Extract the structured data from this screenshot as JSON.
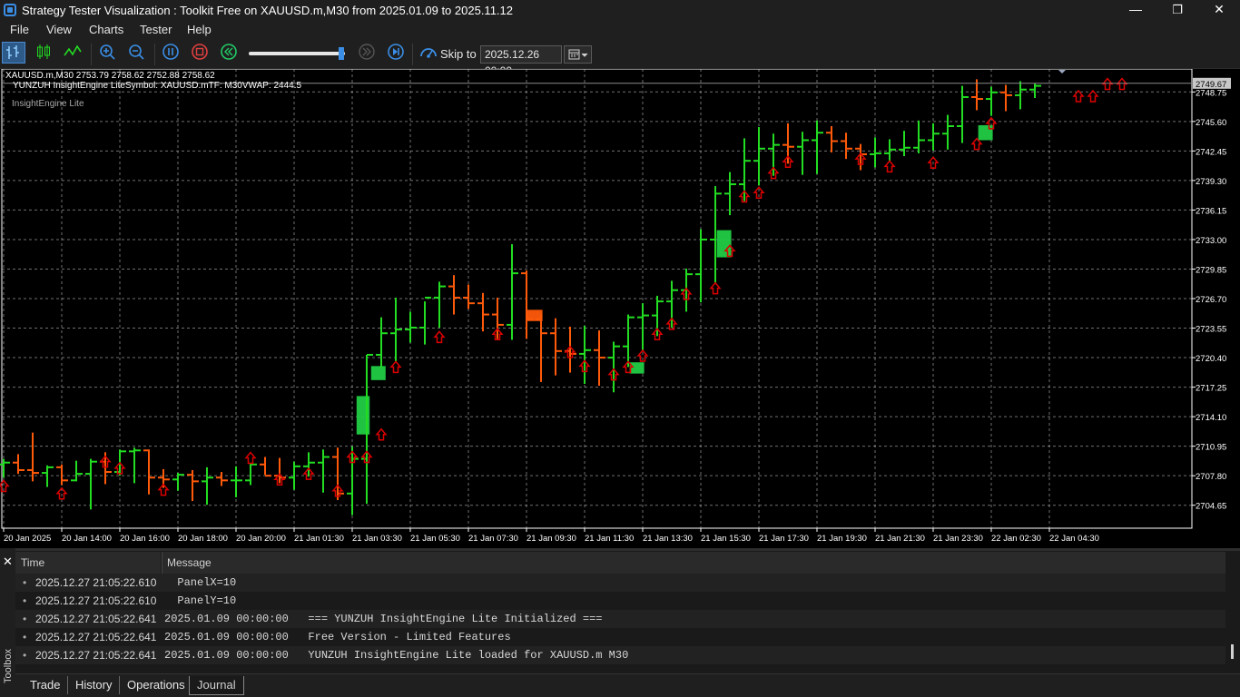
{
  "window": {
    "title": "Strategy Tester Visualization : Toolkit Free on XAUUSD.m,M30 from 2025.01.09 to 2025.11.12",
    "minimize": "—",
    "maximize": "❐",
    "close": "✕"
  },
  "menu": [
    "File",
    "View",
    "Charts",
    "Tester",
    "Help"
  ],
  "toolbar": {
    "skip_label": "Skip to",
    "skip_date": "2025.12.26 00:00",
    "speed_fraction": 0.96,
    "icons": [
      "bar-chart-icon",
      "candlestick-icon",
      "line-chart-icon",
      "zoom-in-icon",
      "zoom-out-icon",
      "pause-icon",
      "stop-icon",
      "rewind-icon",
      "skip-disabled-icon",
      "step-forward-icon",
      "skip-to-icon",
      "calendar-icon"
    ]
  },
  "chart_header": {
    "symbol_line": "XAUUSD.m,M30  2753.79 2758.62 2752.88 2758.62",
    "indicator_line": "YUNZUH InsightEngine LiteSymbol: XAUUSD.mTF: M30VWAP: 2444.5",
    "indicator_name": "InsightEngine Lite",
    "current_price": "2749.67"
  },
  "colors": {
    "bull_bar": "#22dd22",
    "bear_bar": "#ff5a0a",
    "grid": "#cccccc",
    "arrow": "#dd0000",
    "zone_fill": "#22cc44"
  },
  "chart_data": {
    "type": "ohlc",
    "ylim": [
      2702.2,
      2751.2
    ],
    "price_ticks": [
      2748.75,
      2745.6,
      2742.45,
      2739.3,
      2736.15,
      2733.0,
      2729.85,
      2726.7,
      2723.55,
      2720.4,
      2717.25,
      2714.1,
      2710.95,
      2707.8,
      2704.65
    ],
    "price_tick_labels": [
      "2748.75",
      "2745.60",
      "2742.45",
      "2739.30",
      "2736.15",
      "2733.00",
      "2729.85",
      "2726.70",
      "2723.55",
      "2720.40",
      "2717.25",
      "2714.10",
      "2710.95",
      "2707.80",
      "2704.65"
    ],
    "time_labels": [
      "20 Jan 2025",
      "20 Jan 14:00",
      "20 Jan 16:00",
      "20 Jan 18:00",
      "20 Jan 20:00",
      "21 Jan 01:30",
      "21 Jan 03:30",
      "21 Jan 05:30",
      "21 Jan 07:30",
      "21 Jan 09:30",
      "21 Jan 11:30",
      "21 Jan 13:30",
      "21 Jan 15:30",
      "21 Jan 17:30",
      "21 Jan 19:30",
      "21 Jan 21:30",
      "21 Jan 23:30",
      "22 Jan 02:30",
      "22 Jan 04:30"
    ],
    "time_label_index": [
      0,
      4,
      8,
      12,
      16,
      20,
      24,
      28,
      32,
      36,
      40,
      44,
      48,
      52,
      56,
      60,
      64,
      68,
      72
    ],
    "bars": [
      {
        "o": 2709.0,
        "h": 2709.6,
        "l": 2707.6,
        "c": 2709.2
      },
      {
        "o": 2709.2,
        "h": 2710.1,
        "l": 2708.0,
        "c": 2708.4
      },
      {
        "o": 2708.4,
        "h": 2712.4,
        "l": 2707.2,
        "c": 2708.1
      },
      {
        "o": 2708.1,
        "h": 2708.9,
        "l": 2706.6,
        "c": 2708.7
      },
      {
        "o": 2708.7,
        "h": 2709.0,
        "l": 2706.8,
        "c": 2707.3
      },
      {
        "o": 2707.3,
        "h": 2709.4,
        "l": 2707.2,
        "c": 2708.0
      },
      {
        "o": 2708.0,
        "h": 2709.6,
        "l": 2704.2,
        "c": 2709.3
      },
      {
        "o": 2709.3,
        "h": 2710.3,
        "l": 2706.9,
        "c": 2708.2
      },
      {
        "o": 2708.2,
        "h": 2710.6,
        "l": 2707.8,
        "c": 2710.4
      },
      {
        "o": 2710.4,
        "h": 2710.8,
        "l": 2707.0,
        "c": 2710.5
      },
      {
        "o": 2710.5,
        "h": 2710.6,
        "l": 2705.8,
        "c": 2707.6
      },
      {
        "o": 2707.6,
        "h": 2708.5,
        "l": 2706.5,
        "c": 2707.4
      },
      {
        "o": 2707.4,
        "h": 2708.1,
        "l": 2706.2,
        "c": 2707.9
      },
      {
        "o": 2707.9,
        "h": 2708.4,
        "l": 2705.1,
        "c": 2707.2
      },
      {
        "o": 2707.2,
        "h": 2708.7,
        "l": 2704.7,
        "c": 2707.6
      },
      {
        "o": 2707.6,
        "h": 2708.2,
        "l": 2706.7,
        "c": 2707.3
      },
      {
        "o": 2707.3,
        "h": 2708.8,
        "l": 2705.5,
        "c": 2707.3
      },
      {
        "o": 2707.3,
        "h": 2709.1,
        "l": 2706.8,
        "c": 2709.0
      },
      {
        "o": 2709.0,
        "h": 2709.8,
        "l": 2707.9,
        "c": 2707.8
      },
      {
        "o": 2707.8,
        "h": 2709.7,
        "l": 2707.0,
        "c": 2707.6
      },
      {
        "o": 2707.6,
        "h": 2709.3,
        "l": 2706.3,
        "c": 2708.8
      },
      {
        "o": 2708.8,
        "h": 2710.3,
        "l": 2707.7,
        "c": 2709.2
      },
      {
        "o": 2709.2,
        "h": 2710.6,
        "l": 2706.0,
        "c": 2709.8
      },
      {
        "o": 2709.8,
        "h": 2710.8,
        "l": 2705.2,
        "c": 2705.9
      },
      {
        "o": 2705.9,
        "h": 2710.9,
        "l": 2703.6,
        "c": 2709.6
      },
      {
        "o": 2709.6,
        "h": 2720.7,
        "l": 2704.8,
        "c": 2720.7
      },
      {
        "o": 2720.7,
        "h": 2724.7,
        "l": 2719.3,
        "c": 2723.0
      },
      {
        "o": 2723.0,
        "h": 2726.8,
        "l": 2720.0,
        "c": 2723.4
      },
      {
        "o": 2723.4,
        "h": 2725.3,
        "l": 2722.0,
        "c": 2723.6
      },
      {
        "o": 2723.6,
        "h": 2726.4,
        "l": 2721.8,
        "c": 2726.8
      },
      {
        "o": 2726.8,
        "h": 2728.5,
        "l": 2723.6,
        "c": 2728.0
      },
      {
        "o": 2728.0,
        "h": 2729.2,
        "l": 2725.0,
        "c": 2726.8
      },
      {
        "o": 2726.8,
        "h": 2728.2,
        "l": 2725.6,
        "c": 2726.2
      },
      {
        "o": 2726.2,
        "h": 2727.3,
        "l": 2723.2,
        "c": 2725.0
      },
      {
        "o": 2725.0,
        "h": 2726.8,
        "l": 2722.4,
        "c": 2723.9
      },
      {
        "o": 2723.9,
        "h": 2732.5,
        "l": 2722.3,
        "c": 2729.4
      },
      {
        "o": 2729.4,
        "h": 2729.7,
        "l": 2722.4,
        "c": 2724.5
      },
      {
        "o": 2724.5,
        "h": 2725.0,
        "l": 2717.8,
        "c": 2723.0
      },
      {
        "o": 2723.0,
        "h": 2724.6,
        "l": 2718.5,
        "c": 2721.1
      },
      {
        "o": 2721.1,
        "h": 2723.7,
        "l": 2718.8,
        "c": 2720.8
      },
      {
        "o": 2720.8,
        "h": 2723.8,
        "l": 2717.6,
        "c": 2721.2
      },
      {
        "o": 2721.2,
        "h": 2723.3,
        "l": 2717.4,
        "c": 2720.4
      },
      {
        "o": 2720.4,
        "h": 2722.1,
        "l": 2716.7,
        "c": 2721.6
      },
      {
        "o": 2721.6,
        "h": 2725.0,
        "l": 2719.4,
        "c": 2724.7
      },
      {
        "o": 2724.7,
        "h": 2726.2,
        "l": 2721.2,
        "c": 2724.9
      },
      {
        "o": 2724.9,
        "h": 2727.0,
        "l": 2722.7,
        "c": 2726.4
      },
      {
        "o": 2726.4,
        "h": 2728.6,
        "l": 2723.6,
        "c": 2727.6
      },
      {
        "o": 2727.6,
        "h": 2729.9,
        "l": 2725.3,
        "c": 2729.3
      },
      {
        "o": 2729.3,
        "h": 2734.1,
        "l": 2726.3,
        "c": 2733.0
      },
      {
        "o": 2733.0,
        "h": 2738.7,
        "l": 2728.4,
        "c": 2737.9
      },
      {
        "o": 2737.9,
        "h": 2740.2,
        "l": 2735.6,
        "c": 2738.9
      },
      {
        "o": 2738.9,
        "h": 2743.8,
        "l": 2737.1,
        "c": 2741.4
      },
      {
        "o": 2741.4,
        "h": 2745.0,
        "l": 2738.8,
        "c": 2742.7
      },
      {
        "o": 2742.7,
        "h": 2744.3,
        "l": 2739.8,
        "c": 2743.1
      },
      {
        "o": 2743.1,
        "h": 2745.4,
        "l": 2741.1,
        "c": 2742.9
      },
      {
        "o": 2742.9,
        "h": 2744.5,
        "l": 2739.9,
        "c": 2743.6
      },
      {
        "o": 2743.6,
        "h": 2745.7,
        "l": 2740.0,
        "c": 2744.4
      },
      {
        "o": 2744.4,
        "h": 2745.1,
        "l": 2742.3,
        "c": 2743.5
      },
      {
        "o": 2743.5,
        "h": 2744.4,
        "l": 2741.6,
        "c": 2742.7
      },
      {
        "o": 2742.7,
        "h": 2743.2,
        "l": 2740.4,
        "c": 2742.1
      },
      {
        "o": 2742.1,
        "h": 2743.9,
        "l": 2740.7,
        "c": 2742.2
      },
      {
        "o": 2742.2,
        "h": 2743.7,
        "l": 2741.4,
        "c": 2742.6
      },
      {
        "o": 2742.6,
        "h": 2744.6,
        "l": 2741.9,
        "c": 2742.8
      },
      {
        "o": 2742.8,
        "h": 2745.7,
        "l": 2742.2,
        "c": 2743.6
      },
      {
        "o": 2743.6,
        "h": 2745.4,
        "l": 2742.5,
        "c": 2744.3
      },
      {
        "o": 2744.3,
        "h": 2746.3,
        "l": 2742.6,
        "c": 2745.1
      },
      {
        "o": 2745.1,
        "h": 2749.4,
        "l": 2743.3,
        "c": 2748.2
      },
      {
        "o": 2748.2,
        "h": 2750.1,
        "l": 2746.8,
        "c": 2748.0
      },
      {
        "o": 2748.0,
        "h": 2749.3,
        "l": 2746.2,
        "c": 2748.7
      },
      {
        "o": 2748.7,
        "h": 2749.5,
        "l": 2746.7,
        "c": 2748.4
      },
      {
        "o": 2748.4,
        "h": 2749.9,
        "l": 2746.9,
        "c": 2749.0
      },
      {
        "o": 2749.0,
        "h": 2749.7,
        "l": 2748.1,
        "c": 2749.4
      }
    ],
    "zones": [
      {
        "from": 24.3,
        "to": 25.2,
        "top": 2716.3,
        "bottom": 2712.2,
        "color": "bull"
      },
      {
        "from": 25.3,
        "to": 26.3,
        "top": 2719.5,
        "bottom": 2718.0,
        "color": "bull"
      },
      {
        "from": 36.0,
        "to": 37.1,
        "top": 2725.5,
        "bottom": 2724.3,
        "color": "bear"
      },
      {
        "from": 43.1,
        "to": 44.1,
        "top": 2719.9,
        "bottom": 2718.7,
        "color": "bull"
      },
      {
        "from": 49.1,
        "to": 50.1,
        "top": 2734.0,
        "bottom": 2731.1,
        "color": "bull"
      },
      {
        "from": 67.1,
        "to": 68.1,
        "top": 2745.2,
        "bottom": 2743.6,
        "color": "bull"
      }
    ],
    "arrow_bars": [
      0,
      4,
      7,
      8,
      11,
      17,
      19,
      21,
      23,
      24,
      25,
      26,
      27,
      30,
      34,
      39,
      40,
      42,
      43,
      44,
      45,
      46,
      47,
      49,
      50,
      51,
      52,
      53,
      54,
      59,
      61,
      64,
      67,
      68,
      74,
      75,
      76,
      77
    ],
    "arrow_prices": [
      2706.7,
      2705.9,
      2709.3,
      2708.6,
      2706.3,
      2709.7,
      2707.4,
      2708.0,
      2706.2,
      2709.8,
      2709.8,
      2712.2,
      2719.4,
      2722.6,
      2722.9,
      2721.0,
      2719.5,
      2718.6,
      2719.4,
      2720.6,
      2722.9,
      2724.0,
      2727.2,
      2727.8,
      2731.8,
      2737.6,
      2738.0,
      2740.1,
      2741.3,
      2741.6,
      2740.8,
      2741.2,
      2743.2,
      2745.4,
      2748.3,
      2748.3,
      2749.6,
      2749.6
    ],
    "current_price": 2749.67
  },
  "journal": {
    "columns": [
      "Time",
      "Message"
    ],
    "rows": [
      {
        "time": "2025.12.27 21:05:22.610",
        "message": "  PanelX=10"
      },
      {
        "time": "2025.12.27 21:05:22.610",
        "message": "  PanelY=10"
      },
      {
        "time": "2025.12.27 21:05:22.641",
        "message": "2025.01.09 00:00:00   === YUNZUH InsightEngine Lite Initialized ==="
      },
      {
        "time": "2025.12.27 21:05:22.641",
        "message": "2025.01.09 00:00:00   Free Version - Limited Features"
      },
      {
        "time": "2025.12.27 21:05:22.641",
        "message": "2025.01.09 00:00:00   YUNZUH InsightEngine Lite loaded for XAUUSD.m M30"
      }
    ]
  },
  "toolbox": {
    "label": "Toolbox",
    "close": "✕",
    "tabs": [
      "Trade",
      "History",
      "Operations",
      "Journal"
    ],
    "active_tab": "Journal"
  }
}
